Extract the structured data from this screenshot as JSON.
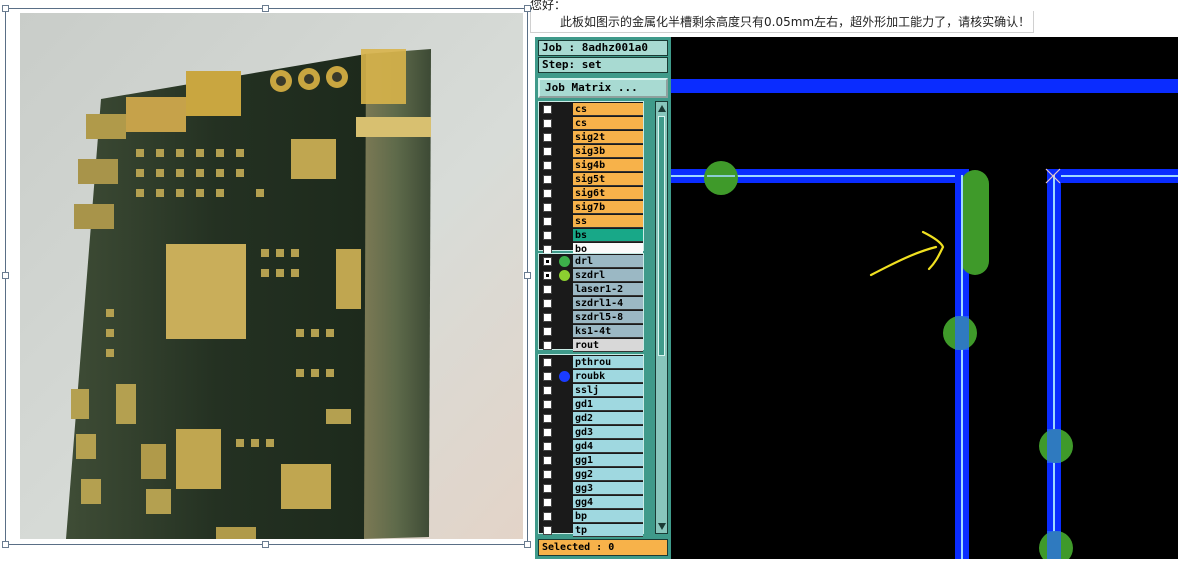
{
  "message": {
    "greeting": "您好：",
    "body": "此板如图示的金属化半槽剩余高度只有0.05mm左右，超外形加工能力了，请核实确认！"
  },
  "header": {
    "job": "Job : 8adhz001a0",
    "step": "Step: set",
    "job_matrix_button": "Job Matrix ..."
  },
  "layers": {
    "group1": [
      {
        "name": "cs",
        "color": "orange",
        "checked": false
      },
      {
        "name": "cs",
        "color": "orange",
        "checked": false
      },
      {
        "name": "sig2t",
        "color": "orange",
        "checked": false
      },
      {
        "name": "sig3b",
        "color": "orange",
        "checked": false
      },
      {
        "name": "sig4b",
        "color": "orange",
        "checked": false
      },
      {
        "name": "sig5t",
        "color": "orange",
        "checked": false
      },
      {
        "name": "sig6t",
        "color": "orange",
        "checked": false
      },
      {
        "name": "sig7b",
        "color": "orange",
        "checked": false
      },
      {
        "name": "ss",
        "color": "orange",
        "checked": false
      },
      {
        "name": "bs",
        "color": "teal",
        "checked": false
      },
      {
        "name": "bo",
        "color": "white",
        "checked": false
      }
    ],
    "group2": [
      {
        "name": "drl",
        "color": "steel",
        "checked": true,
        "dot": "#3db04a"
      },
      {
        "name": "szdrl",
        "color": "steel",
        "checked": true,
        "dot": "#8cd030"
      },
      {
        "name": "laser1-2",
        "color": "steel",
        "checked": false
      },
      {
        "name": "szdrl1-4",
        "color": "steel",
        "checked": false
      },
      {
        "name": "szdrl5-8",
        "color": "steel",
        "checked": false
      },
      {
        "name": "ks1-4t",
        "color": "steel",
        "checked": false
      },
      {
        "name": "rout",
        "color": "lightgray",
        "checked": false
      }
    ],
    "group3": [
      {
        "name": "pthrou",
        "color": "aqua",
        "checked": false
      },
      {
        "name": "roubk",
        "color": "aqua",
        "checked": false,
        "dot": "#1a3cff"
      },
      {
        "name": "sslj",
        "color": "aqua",
        "checked": false
      },
      {
        "name": "gd1",
        "color": "aqua",
        "checked": false
      },
      {
        "name": "gd2",
        "color": "aqua",
        "checked": false
      },
      {
        "name": "gd3",
        "color": "aqua",
        "checked": false
      },
      {
        "name": "gd4",
        "color": "aqua",
        "checked": false
      },
      {
        "name": "gg1",
        "color": "aqua",
        "checked": false
      },
      {
        "name": "gg2",
        "color": "aqua",
        "checked": false
      },
      {
        "name": "gg3",
        "color": "aqua",
        "checked": false
      },
      {
        "name": "gg4",
        "color": "aqua",
        "checked": false
      },
      {
        "name": "bp",
        "color": "aqua",
        "checked": false
      },
      {
        "name": "tp",
        "color": "aqua",
        "checked": false
      }
    ]
  },
  "status": {
    "selected": "Selected : 0"
  },
  "colors": {
    "panel": "#3f9a8a",
    "trace_blue": "#0a2cff",
    "pad_green": "#3f9a2a",
    "annotation_yellow": "#f0e020"
  }
}
